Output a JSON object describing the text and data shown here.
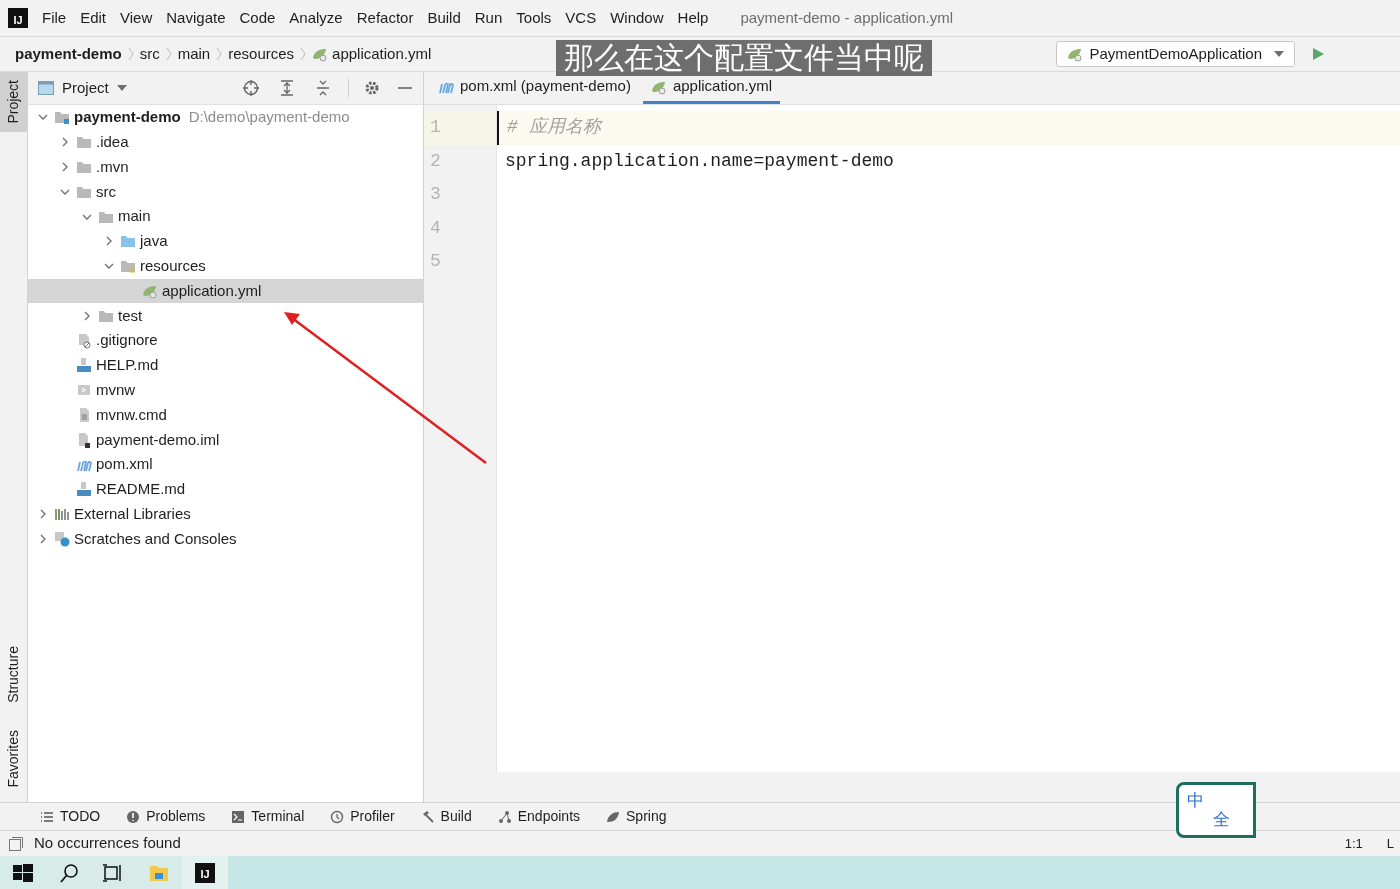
{
  "window": {
    "logo_text": "IJ",
    "menu": [
      "File",
      "Edit",
      "View",
      "Navigate",
      "Code",
      "Analyze",
      "Refactor",
      "Build",
      "Run",
      "Tools",
      "VCS",
      "Window",
      "Help"
    ],
    "title": "payment-demo - application.yml"
  },
  "breadcrumb": [
    {
      "label": "payment-demo",
      "kind": "project"
    },
    {
      "label": "src",
      "kind": "folder"
    },
    {
      "label": "main",
      "kind": "folder"
    },
    {
      "label": "resources",
      "kind": "folder"
    },
    {
      "label": "application.yml",
      "kind": "yaml"
    }
  ],
  "run_config": {
    "label": "PaymentDemoApplication"
  },
  "subtitle": "那么在这个配置文件当中呢",
  "side_tabs_top": [
    {
      "label": "Project",
      "selected": true
    }
  ],
  "side_tabs_bottom": [
    {
      "label": "Structure",
      "selected": false
    },
    {
      "label": "Favorites",
      "selected": false
    }
  ],
  "project_panel": {
    "title": "Project"
  },
  "tree": [
    {
      "name": "payment-demo",
      "hint": "D:\\demo\\payment-demo",
      "kind": "module",
      "expanded": true,
      "selected": false,
      "children": [
        {
          "name": ".idea",
          "kind": "folder",
          "expanded": false,
          "selected": false
        },
        {
          "name": ".mvn",
          "kind": "folder",
          "expanded": false,
          "selected": false
        },
        {
          "name": "src",
          "kind": "folder",
          "expanded": true,
          "selected": false,
          "children": [
            {
              "name": "main",
              "kind": "folder",
              "expanded": true,
              "selected": false,
              "children": [
                {
                  "name": "java",
                  "kind": "source",
                  "expanded": false,
                  "selected": false
                },
                {
                  "name": "resources",
                  "kind": "resources",
                  "expanded": true,
                  "selected": false,
                  "children": [
                    {
                      "name": "application.yml",
                      "kind": "yaml",
                      "selected": true
                    }
                  ]
                }
              ]
            },
            {
              "name": "test",
              "kind": "folder",
              "expanded": false,
              "selected": false
            }
          ]
        },
        {
          "name": ".gitignore",
          "kind": "ignore",
          "selected": false
        },
        {
          "name": "HELP.md",
          "kind": "markdown",
          "selected": false
        },
        {
          "name": "mvnw",
          "kind": "script",
          "selected": false
        },
        {
          "name": "mvnw.cmd",
          "kind": "text",
          "selected": false
        },
        {
          "name": "payment-demo.iml",
          "kind": "iml",
          "selected": false
        },
        {
          "name": "pom.xml",
          "kind": "maven",
          "selected": false
        },
        {
          "name": "README.md",
          "kind": "markdown",
          "selected": false
        }
      ]
    },
    {
      "name": "External Libraries",
      "kind": "libraries",
      "expanded": false,
      "selected": false
    },
    {
      "name": "Scratches and Consoles",
      "kind": "scratches",
      "expanded": false,
      "selected": false
    }
  ],
  "editor_tabs": [
    {
      "label": "pom.xml (payment-demo)",
      "kind": "maven",
      "selected": false
    },
    {
      "label": "application.yml",
      "kind": "yaml",
      "selected": true
    }
  ],
  "editor": {
    "line_numbers": [
      "1",
      "2",
      "3",
      "4",
      "5"
    ],
    "lines": [
      {
        "kind": "comment",
        "text": "# 应用名称",
        "current": true
      },
      {
        "kind": "code",
        "text": "spring.application.name=payment-demo",
        "current": false
      }
    ]
  },
  "bottom_tools": [
    {
      "label": "TODO",
      "kind": "list"
    },
    {
      "label": "Problems",
      "kind": "alert"
    },
    {
      "label": "Terminal",
      "kind": "terminal"
    },
    {
      "label": "Profiler",
      "kind": "profiler"
    },
    {
      "label": "Build",
      "kind": "hammer"
    },
    {
      "label": "Endpoints",
      "kind": "endpoints"
    },
    {
      "label": "Spring",
      "kind": "leaf"
    }
  ],
  "status_bar": {
    "message": "No occurrences found",
    "position": "1:1",
    "column_2": "L"
  },
  "ime": {
    "mode": "中",
    "width": "全"
  },
  "taskbar": {
    "logo_text": "IJ"
  }
}
